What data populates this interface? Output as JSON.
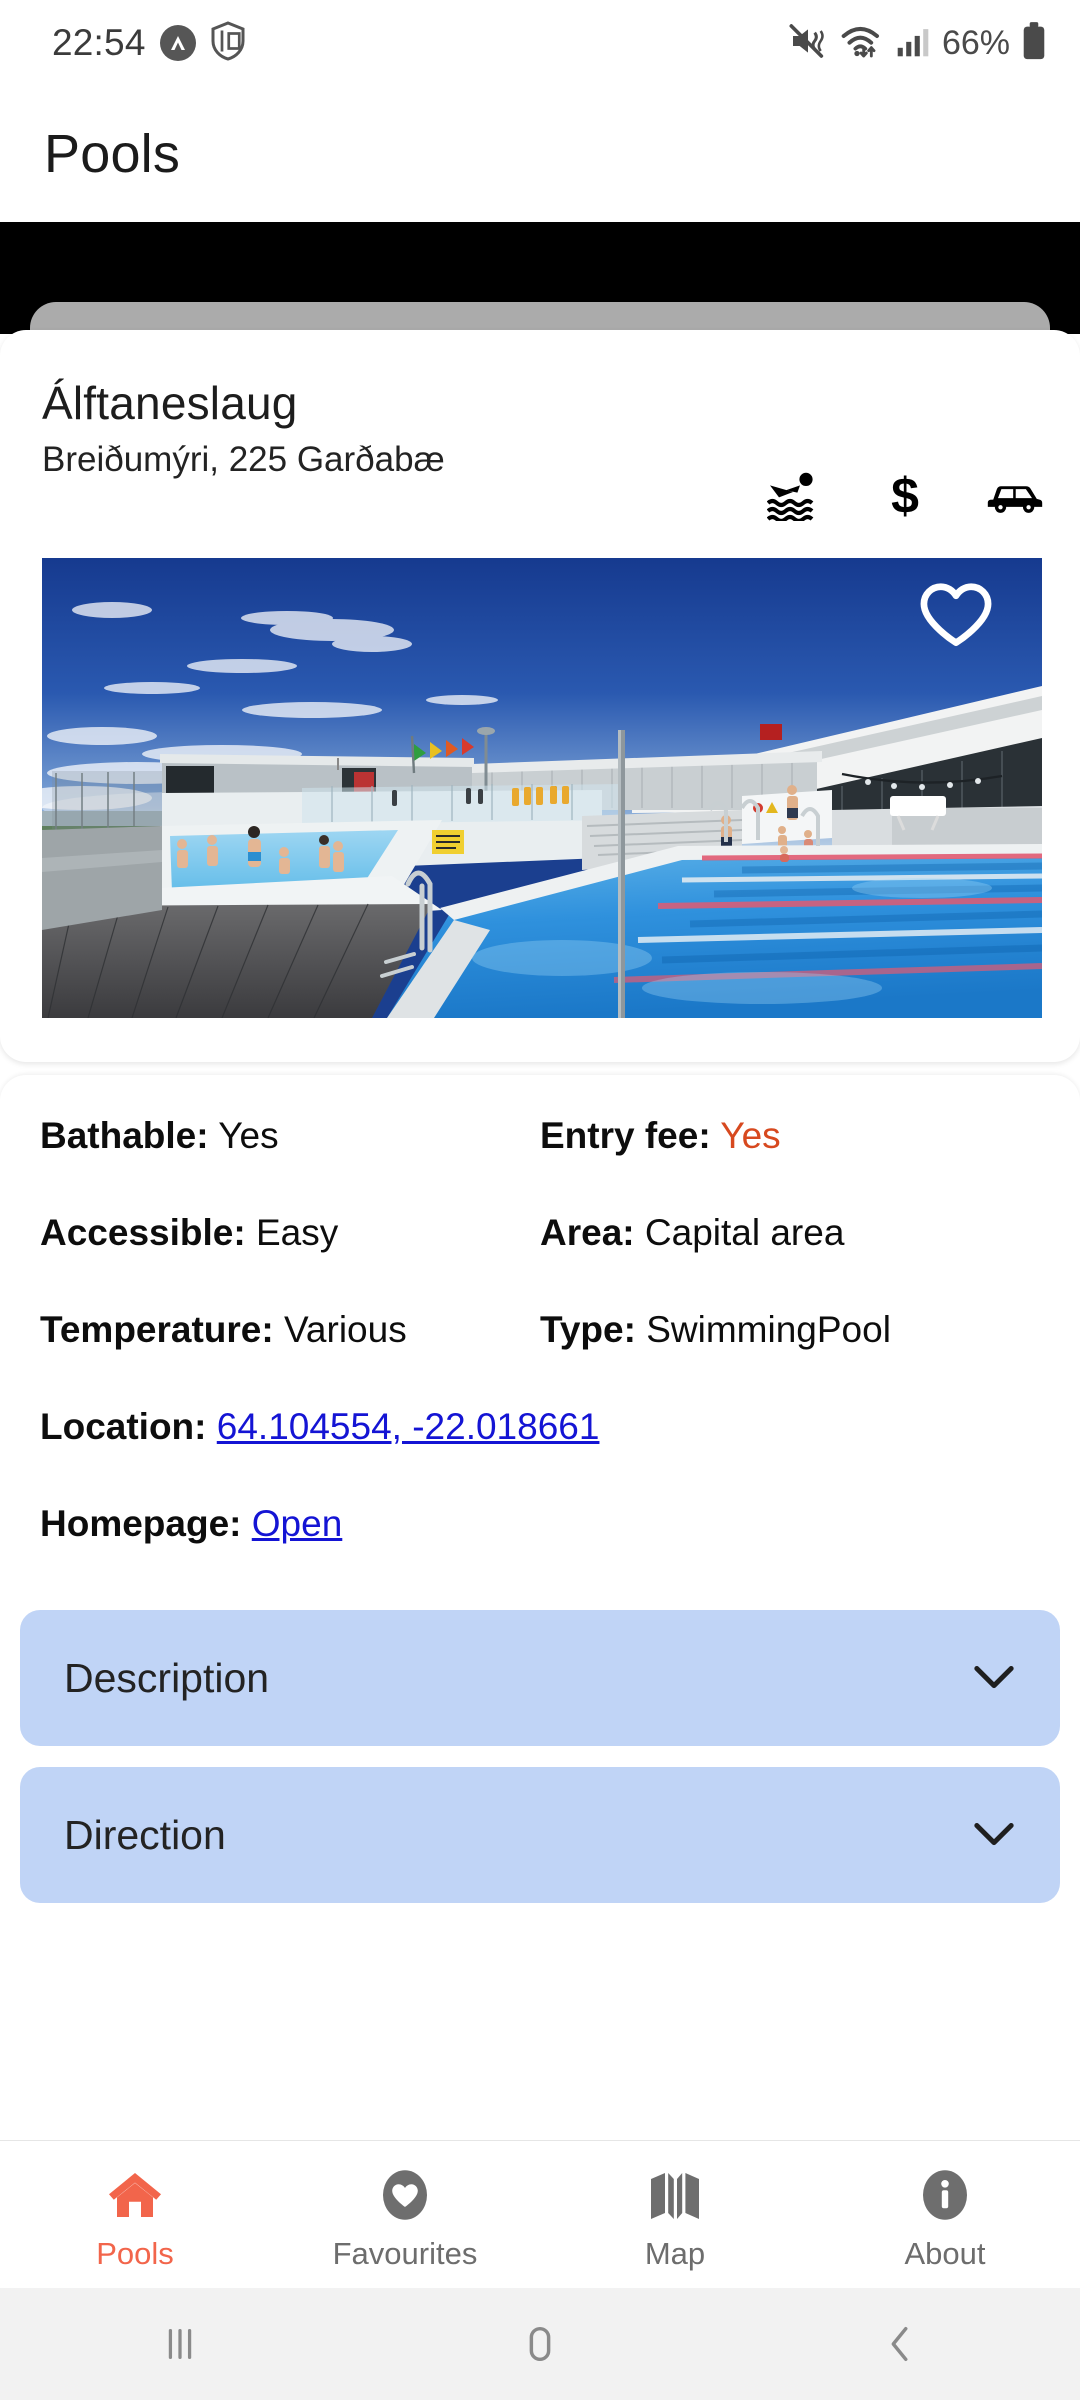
{
  "status_bar": {
    "time": "22:54",
    "battery_percent": "66%",
    "icons": [
      "app-badge-icon",
      "shield-icon",
      "mute-vibrate-icon",
      "wifi-icon",
      "signal-bars-icon",
      "battery-icon"
    ]
  },
  "app_bar": {
    "title": "Pools"
  },
  "pool": {
    "name": "Álftaneslaug",
    "address": "Breiðumýri, 225 Garðabæ",
    "facilities": [
      {
        "name": "swimmer-icon",
        "label": "Swimming"
      },
      {
        "name": "dollar-icon",
        "label": "$"
      },
      {
        "name": "car-icon",
        "label": "Parking"
      }
    ],
    "favourite_icon": "heart-outline-icon",
    "favourited": false,
    "photo_alt": "Álftaneslaug outdoor swimming pool"
  },
  "details": [
    {
      "key": "Bathable:",
      "value": "Yes",
      "accent": false
    },
    {
      "key": "Entry fee:",
      "value": "Yes",
      "accent": true
    },
    {
      "key": "Accessible:",
      "value": "Easy",
      "accent": false
    },
    {
      "key": "Area:",
      "value": "Capital area",
      "accent": false
    },
    {
      "key": "Temperature:",
      "value": "Various",
      "accent": false
    },
    {
      "key": "Type:",
      "value": "SwimmingPool",
      "accent": false
    }
  ],
  "location": {
    "key": "Location:",
    "value": "64.104554, -22.018661"
  },
  "homepage": {
    "key": "Homepage:",
    "value": "Open"
  },
  "expanders": [
    {
      "label": "Description",
      "icon": "chevron-down-icon",
      "expanded": false
    },
    {
      "label": "Direction",
      "icon": "chevron-down-icon",
      "expanded": false
    }
  ],
  "tabs": [
    {
      "label": "Pools",
      "icon": "home-icon",
      "active": true
    },
    {
      "label": "Favourites",
      "icon": "heart-filled-icon",
      "active": false
    },
    {
      "label": "Map",
      "icon": "map-icon",
      "active": false
    },
    {
      "label": "About",
      "icon": "info-icon",
      "active": false
    }
  ],
  "system_nav": [
    {
      "name": "recents-button",
      "icon": "recents-icon"
    },
    {
      "name": "home-button",
      "icon": "home-pill-icon"
    },
    {
      "name": "back-button",
      "icon": "back-chevron-icon"
    }
  ],
  "colors": {
    "accent_orange": "#f2654b",
    "entry_fee_red": "#d7491f",
    "link_blue": "#1414d4",
    "expander_blue": "#c0d4f6"
  }
}
